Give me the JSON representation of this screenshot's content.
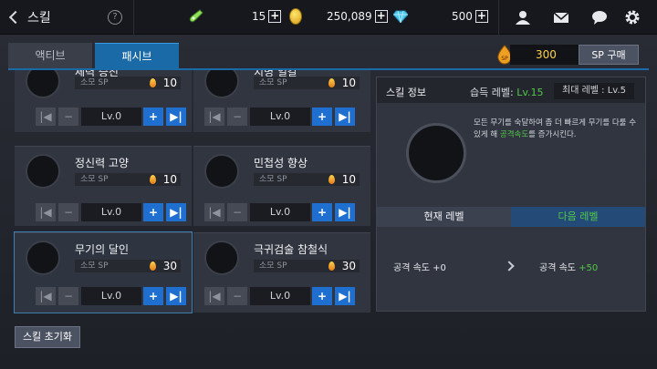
{
  "header": {
    "title": "스킬",
    "help": "?",
    "potion_count": "15",
    "gold": "250,089",
    "gem": "500"
  },
  "tabs": [
    {
      "label": "액티브"
    },
    {
      "label": "패시브"
    }
  ],
  "sp": {
    "value": "300",
    "buy_label": "SP 구매"
  },
  "cost_label": "소모 SP",
  "level_label": "Lv.0",
  "skills": [
    {
      "name": "체력 증진",
      "cost": "10",
      "level": "Lv.0"
    },
    {
      "name": "치명 일갈",
      "cost": "10",
      "level": "Lv.0"
    },
    {
      "name": "정신력 고양",
      "cost": "10",
      "level": "Lv.0"
    },
    {
      "name": "민첩성 향상",
      "cost": "10",
      "level": "Lv.0"
    },
    {
      "name": "무기의 달인",
      "cost": "30",
      "level": "Lv.0"
    },
    {
      "name": "극귀검술 참철식",
      "cost": "30",
      "level": "Lv.0"
    }
  ],
  "info": {
    "title": "스킬 정보",
    "learn_label": "습득 레벨:",
    "learn_value": "Lv.15",
    "max_level": "최대 레벨 : Lv.5",
    "desc_pre": "모든 무기를 숙달하여 좀 더 빠르게 무기를 다룰 수 있게 해 ",
    "desc_hl": "공격속도",
    "desc_post": "를 증가시킨다.",
    "current_label": "현재 레벨",
    "next_label": "다음 레벨",
    "current_stat_name": "공격 속도",
    "current_stat_value": "+0",
    "next_stat_name": "공격 속도",
    "next_stat_value": "+50"
  },
  "reset_label": "스킬 초기화",
  "colors": {
    "accent": "#1a6aa8",
    "green": "#52c84a",
    "gold": "#ffd24a"
  }
}
